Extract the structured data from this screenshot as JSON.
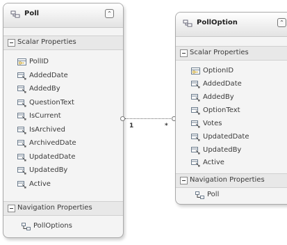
{
  "entities": [
    {
      "title": "Poll",
      "icon": "entity-type-icon",
      "sections": [
        {
          "label": "Scalar Properties",
          "items": [
            {
              "label": "PollID",
              "icon": "key-icon"
            },
            {
              "label": "AddedDate",
              "icon": "property-icon"
            },
            {
              "label": "AddedBy",
              "icon": "property-icon"
            },
            {
              "label": "QuestionText",
              "icon": "property-icon"
            },
            {
              "label": "IsCurrent",
              "icon": "property-icon"
            },
            {
              "label": "IsArchived",
              "icon": "property-icon"
            },
            {
              "label": "ArchivedDate",
              "icon": "property-icon"
            },
            {
              "label": "UpdatedDate",
              "icon": "property-icon"
            },
            {
              "label": "UpdatedBy",
              "icon": "property-icon"
            },
            {
              "label": "Active",
              "icon": "property-icon"
            }
          ]
        },
        {
          "label": "Navigation Properties",
          "items": [
            {
              "label": "PollOptions",
              "icon": "navigation-property-icon"
            }
          ]
        }
      ]
    },
    {
      "title": "PollOption",
      "icon": "entity-type-icon",
      "sections": [
        {
          "label": "Scalar Properties",
          "items": [
            {
              "label": "OptionID",
              "icon": "key-icon"
            },
            {
              "label": "AddedDate",
              "icon": "property-icon"
            },
            {
              "label": "AddedBy",
              "icon": "property-icon"
            },
            {
              "label": "OptionText",
              "icon": "property-icon"
            },
            {
              "label": "Votes",
              "icon": "property-icon"
            },
            {
              "label": "UpdatedDate",
              "icon": "property-icon"
            },
            {
              "label": "UpdatedBy",
              "icon": "property-icon"
            },
            {
              "label": "Active",
              "icon": "property-icon"
            }
          ]
        },
        {
          "label": "Navigation Properties",
          "items": [
            {
              "label": "Poll",
              "icon": "navigation-property-icon"
            }
          ]
        }
      ]
    }
  ],
  "association": {
    "source_multiplicity": "1",
    "target_multiplicity": "*",
    "line_style": "dotted"
  },
  "colors": {
    "entity_background": "#f4f4f4",
    "entity_border": "#a9a9a9",
    "section_background": "#e8e8e8",
    "text": "#3a3a3a"
  }
}
